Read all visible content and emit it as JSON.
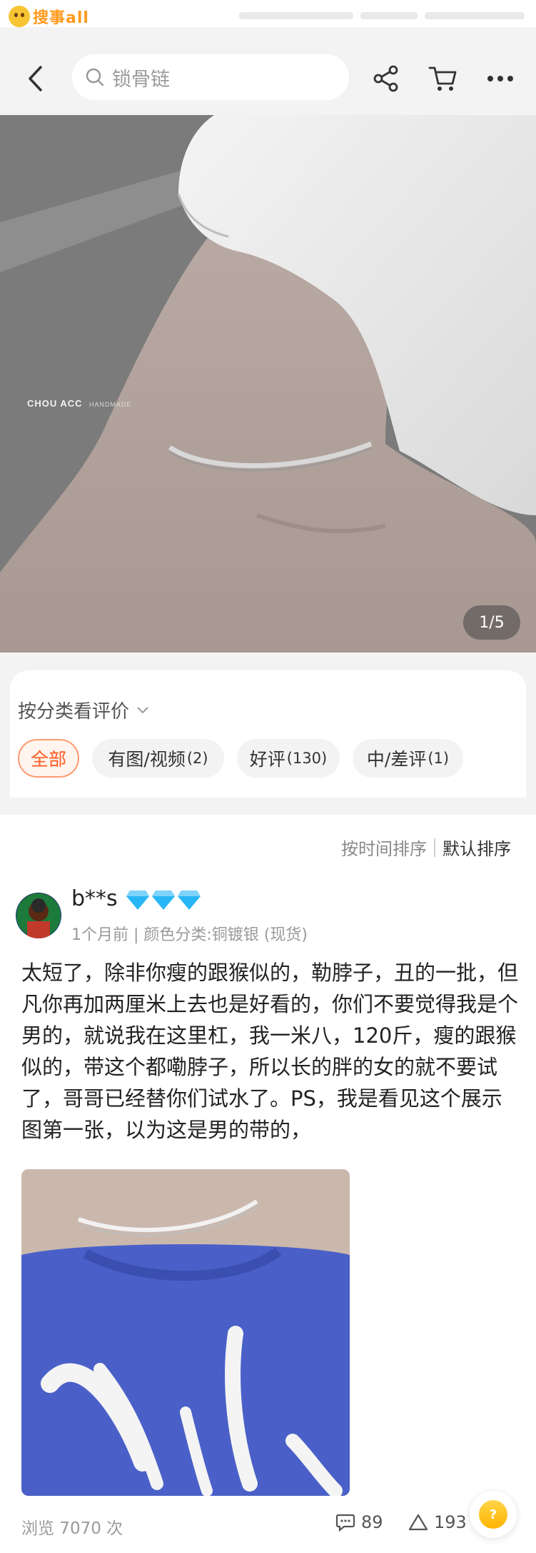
{
  "watermark": {
    "brand_text": "搜事all"
  },
  "header": {
    "search_text": "锁骨链"
  },
  "product_image": {
    "page_counter": "1/5",
    "brand_caption": "CHOU ACC",
    "brand_caption_sub": "HANDMADE"
  },
  "review_filter": {
    "title": "按分类看评价",
    "chips": [
      {
        "label": "全部",
        "count": "",
        "active": true
      },
      {
        "label": "有图/视频",
        "count": "(2)",
        "active": false
      },
      {
        "label": "好评",
        "count": "(130)",
        "active": false
      },
      {
        "label": "中/差评",
        "count": "(1)",
        "active": false
      }
    ]
  },
  "sort": {
    "by_time": "按时间排序",
    "default": "默认排序"
  },
  "review": {
    "username": "b**s",
    "meta": "1个月前 | 颜色分类:铜镀银 (现货)",
    "text": "太短了，除非你瘦的跟猴似的，勒脖子，丑的一批，但凡你再加两厘米上去也是好看的，你们不要觉得我是个男的，就说我在这里杠，我一米八，120斤，瘦的跟猴似的，带这个都嘞脖子，所以长的胖的女的就不要试了，哥哥已经替你们试水了。PS，我是看见这个展示图第一张，以为这是男的带的，"
  },
  "stats": {
    "views": "浏览 7070 次",
    "comments": "89",
    "likes": "193"
  },
  "colors": {
    "accent": "#ff5a1f",
    "gem": "#29b6f6",
    "header_bg": "#f3f3f3"
  },
  "icons": [
    "back-icon",
    "search-icon",
    "share-icon",
    "cart-icon",
    "more-icon",
    "chevron-down-icon",
    "diamond-icon",
    "comment-icon",
    "like-icon",
    "question-icon"
  ]
}
